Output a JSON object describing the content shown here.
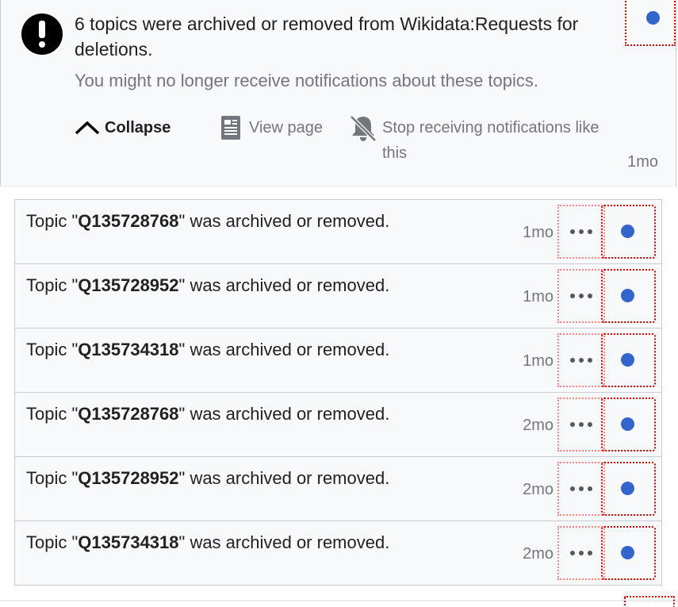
{
  "header": {
    "title": "6 topics were archived or removed from Wikidata:Requests for deletions.",
    "subtitle": "You might no longer receive notifications about these topics.",
    "time": "1mo"
  },
  "actions": {
    "collapse_label": "Collapse",
    "view_page_label": "View page",
    "stop_notifications_label": "Stop receiving notifications like this"
  },
  "items": [
    {
      "prefix": "Topic \"",
      "topic": "Q135728768",
      "suffix": "\" was archived or removed.",
      "time": "1mo"
    },
    {
      "prefix": "Topic \"",
      "topic": "Q135728952",
      "suffix": "\" was archived or removed.",
      "time": "1mo"
    },
    {
      "prefix": "Topic \"",
      "topic": "Q135734318",
      "suffix": "\" was archived or removed.",
      "time": "1mo"
    },
    {
      "prefix": "Topic \"",
      "topic": "Q135728768",
      "suffix": "\" was archived or removed.",
      "time": "2mo"
    },
    {
      "prefix": "Topic \"",
      "topic": "Q135728952",
      "suffix": "\" was archived or removed.",
      "time": "2mo"
    },
    {
      "prefix": "Topic \"",
      "topic": "Q135734318",
      "suffix": "\" was archived or removed.",
      "time": "2mo"
    }
  ],
  "colors": {
    "unread_dot": "#3366cc",
    "muted_text": "#72777d",
    "highlight_border": "#e00000"
  },
  "icons": {
    "alert": "alert-icon",
    "collapse": "chevron-up-icon",
    "view_page": "page-icon",
    "stop": "bell-slash-icon",
    "more": "ellipsis-icon",
    "unread": "unread-dot-icon"
  }
}
